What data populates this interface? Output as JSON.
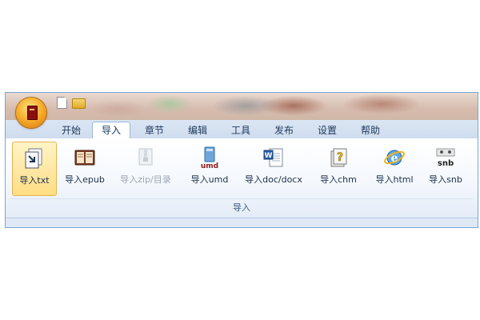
{
  "tabs": [
    {
      "label": "开始",
      "active": false
    },
    {
      "label": "导入",
      "active": true
    },
    {
      "label": "章节",
      "active": false
    },
    {
      "label": "编辑",
      "active": false
    },
    {
      "label": "工具",
      "active": false
    },
    {
      "label": "发布",
      "active": false
    },
    {
      "label": "设置",
      "active": false
    },
    {
      "label": "帮助",
      "active": false
    }
  ],
  "ribbon": {
    "group_label": "导入",
    "buttons": [
      {
        "label": "导入txt",
        "icon": "import-txt-icon",
        "selected": true,
        "disabled": false
      },
      {
        "label": "导入epub",
        "icon": "epub-book-icon",
        "selected": false,
        "disabled": false
      },
      {
        "label": "导入zip/目录",
        "icon": "zip-folder-icon",
        "selected": false,
        "disabled": true
      },
      {
        "label": "导入umd",
        "icon": "umd-book-icon",
        "badge": "umd",
        "selected": false,
        "disabled": false
      },
      {
        "label": "导入doc/docx",
        "icon": "word-document-icon",
        "badge": "W",
        "selected": false,
        "disabled": false
      },
      {
        "label": "导入chm",
        "icon": "chm-help-icon",
        "selected": false,
        "disabled": false
      },
      {
        "label": "导入html",
        "icon": "internet-explorer-icon",
        "selected": false,
        "disabled": false
      },
      {
        "label": "导入snb",
        "icon": "snb-icon",
        "badge": "snb",
        "selected": false,
        "disabled": false
      }
    ]
  },
  "colors": {
    "accent_orb": "#f8b12e",
    "ribbon_border": "#9bb7d9",
    "selected_fill": "#ffdd84"
  }
}
